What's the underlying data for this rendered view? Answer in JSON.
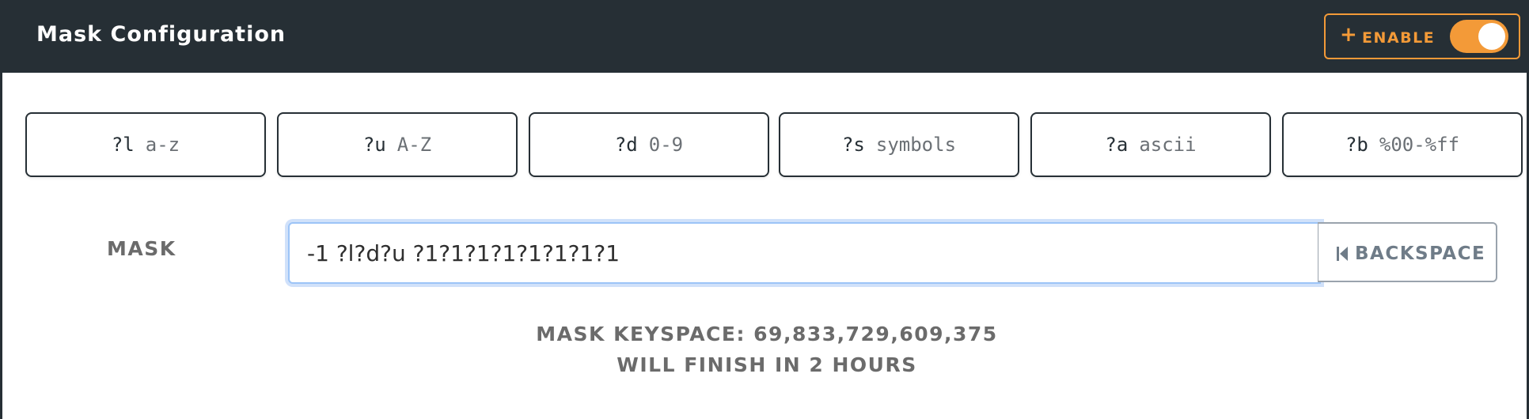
{
  "header": {
    "title": "Mask Configuration",
    "enable_label": "ENABLE",
    "enable_plus": "+",
    "toggle_on": true,
    "accent_color": "#f39a38",
    "bg_color": "#262f35"
  },
  "charsets": [
    {
      "code": "?l",
      "desc": "a-z"
    },
    {
      "code": "?u",
      "desc": "A-Z"
    },
    {
      "code": "?d",
      "desc": "0-9"
    },
    {
      "code": "?s",
      "desc": "symbols"
    },
    {
      "code": "?a",
      "desc": "ascii"
    },
    {
      "code": "?b",
      "desc": "%00-%ff"
    }
  ],
  "mask": {
    "label": "MASK",
    "value": "-1 ?l?d?u ?1?1?1?1?1?1?1?1"
  },
  "backspace": {
    "label": "BACKSPACE",
    "icon": "skip-back-icon"
  },
  "keyspace": {
    "line1": "MASK KEYSPACE: 69,833,729,609,375",
    "line2": "WILL FINISH IN 2 HOURS"
  }
}
